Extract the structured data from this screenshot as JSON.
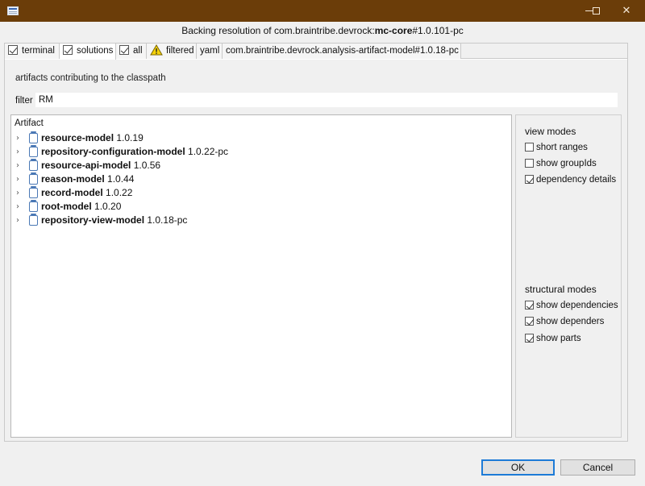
{
  "window": {
    "title_prefix": "Backing resolution of com.braintribe.devrock:",
    "title_bold": "mc-core",
    "title_suffix": "#1.0.101-pc"
  },
  "tabs": [
    {
      "label": "terminal",
      "checkbox": true,
      "checked": true
    },
    {
      "label": "solutions",
      "checkbox": true,
      "checked": true
    },
    {
      "label": "all",
      "checkbox": true,
      "checked": true
    },
    {
      "label": "filtered",
      "icon": "warning-icon"
    },
    {
      "label": "yaml"
    },
    {
      "label": "com.braintribe.devrock.analysis-artifact-model#1.0.18-pc"
    }
  ],
  "main": {
    "section_label": "artifacts contributing to the classpath",
    "filter_label": "filter",
    "filter_value": "RM",
    "tree_header": "Artifact",
    "artifacts": [
      {
        "name": "resource-model",
        "version": "1.0.19"
      },
      {
        "name": "repository-configuration-model",
        "version": "1.0.22-pc"
      },
      {
        "name": "resource-api-model",
        "version": "1.0.56"
      },
      {
        "name": "reason-model",
        "version": "1.0.44"
      },
      {
        "name": "record-model",
        "version": "1.0.22"
      },
      {
        "name": "root-model",
        "version": "1.0.20"
      },
      {
        "name": "repository-view-model",
        "version": "1.0.18-pc"
      }
    ]
  },
  "side": {
    "view_modes_title": "view modes",
    "view_modes": [
      {
        "label": "short ranges",
        "checked": false
      },
      {
        "label": "show groupIds",
        "checked": false
      },
      {
        "label": "dependency details",
        "checked": true
      }
    ],
    "structural_modes_title": "structural modes",
    "structural_modes": [
      {
        "label": "show dependencies",
        "checked": true
      },
      {
        "label": "show dependers",
        "checked": true
      },
      {
        "label": "show parts",
        "checked": true
      }
    ]
  },
  "footer": {
    "ok_label": "OK",
    "cancel_label": "Cancel"
  },
  "colors": {
    "titlebar": "#6b3d09",
    "default_button_border": "#1d7bd7"
  }
}
